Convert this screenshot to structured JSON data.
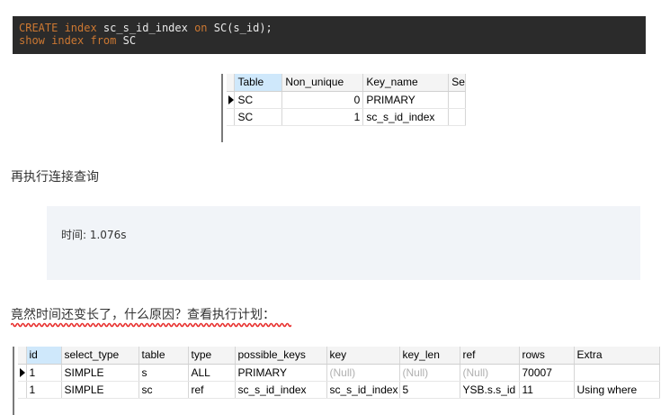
{
  "code": {
    "line1": {
      "t1": "CREATE index",
      "t2": " sc_s_id_index ",
      "t3": "on",
      "t4": " SC(s_id);"
    },
    "line2": {
      "t1": "show index from",
      "t2": " SC"
    }
  },
  "index_grid": {
    "columns": [
      "Table",
      "Non_unique",
      "Key_name",
      "Se"
    ],
    "rows": [
      [
        "SC",
        "0",
        "PRIMARY",
        ""
      ],
      [
        "SC",
        "1",
        "sc_s_id_index",
        ""
      ]
    ]
  },
  "text_join": "再执行连接查询",
  "timing_note": "时间: 1.076s",
  "text_question": "竟然时间还变长了，什么原因？查看执行计划：",
  "underline_color": "#e8312f",
  "explain_grid": {
    "columns": [
      "id",
      "select_type",
      "table",
      "type",
      "possible_keys",
      "key",
      "key_len",
      "ref",
      "rows",
      "Extra"
    ],
    "rows": [
      [
        "1",
        "SIMPLE",
        "s",
        "ALL",
        "PRIMARY",
        "(Null)",
        "(Null)",
        "(Null)",
        "70007",
        ""
      ],
      [
        "1",
        "SIMPLE",
        "sc",
        "ref",
        "sc_s_id_index",
        "sc_s_id_index",
        "5",
        "YSB.s.s_id",
        "11",
        "Using where"
      ]
    ]
  }
}
